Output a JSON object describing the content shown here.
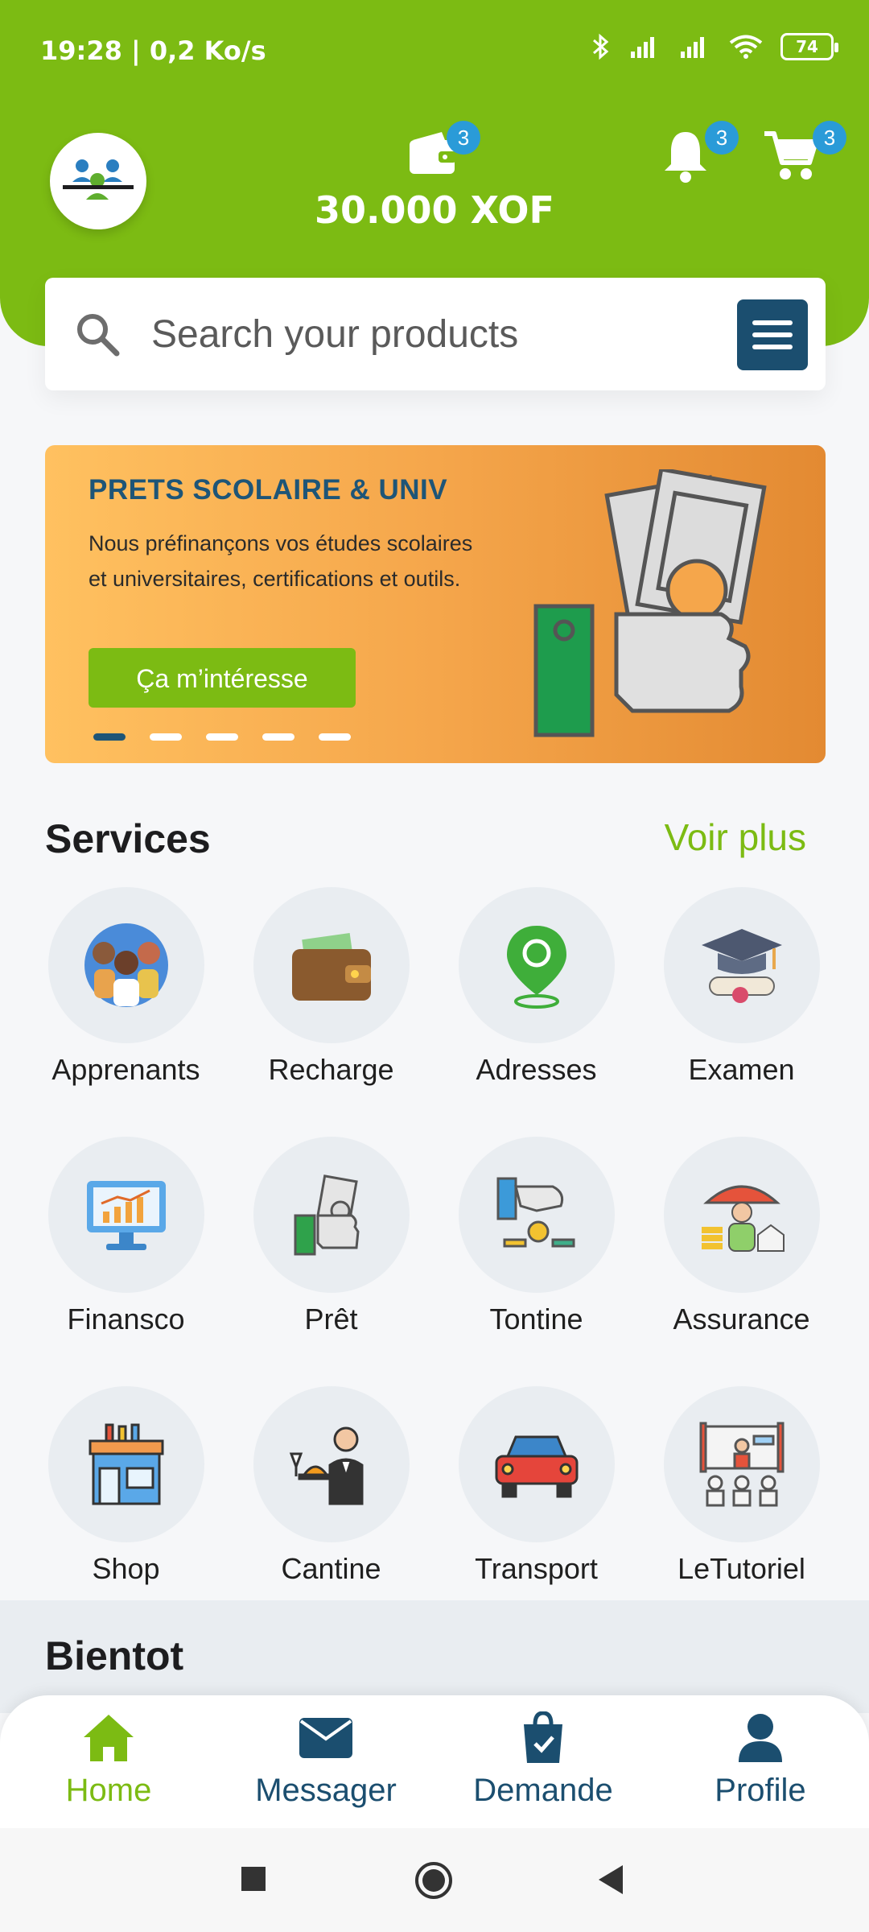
{
  "status_bar": {
    "time_speed": "19:28 | 0,2 Ko/s",
    "battery": "74"
  },
  "header": {
    "wallet_badge": "3",
    "balance": "30.000 XOF",
    "notifications_badge": "3",
    "cart_badge": "3"
  },
  "search": {
    "placeholder": "Search your products"
  },
  "banner": {
    "title": "PRETS SCOLAIRE & UNIV",
    "description": "Nous préfinançons vos études scolaires et universitaires, certifications et outils.",
    "button_label": "Ça m’intéresse",
    "slide_count": 5,
    "active_slide": 1
  },
  "services": {
    "title": "Services",
    "see_more": "Voir plus",
    "items": [
      {
        "label": "Apprenants",
        "icon": "students-icon"
      },
      {
        "label": "Recharge",
        "icon": "wallet-icon"
      },
      {
        "label": "Adresses",
        "icon": "location-pin-icon"
      },
      {
        "label": "Examen",
        "icon": "graduation-cap-icon"
      },
      {
        "label": "Finansco",
        "icon": "monitor-chart-icon"
      },
      {
        "label": "Prêt",
        "icon": "hand-money-icon"
      },
      {
        "label": "Tontine",
        "icon": "coin-hand-icon"
      },
      {
        "label": "Assurance",
        "icon": "umbrella-person-icon"
      },
      {
        "label": "Shop",
        "icon": "shop-icon"
      },
      {
        "label": "Cantine",
        "icon": "waiter-icon"
      },
      {
        "label": "Transport",
        "icon": "car-icon"
      },
      {
        "label": "LeTutoriel",
        "icon": "classroom-icon"
      }
    ]
  },
  "bientot": {
    "title": "Bientot"
  },
  "bottom_nav": {
    "items": [
      {
        "label": "Home",
        "icon": "home-icon",
        "active": true
      },
      {
        "label": "Messager",
        "icon": "mail-icon",
        "active": false
      },
      {
        "label": "Demande",
        "icon": "shopping-bag-icon",
        "active": false
      },
      {
        "label": "Profile",
        "icon": "person-icon",
        "active": false
      }
    ]
  },
  "colors": {
    "brand_green": "#7cbb13",
    "brand_navy": "#1b4e6f",
    "badge_blue": "#2a9bd8",
    "banner_orange": "#f5a64b"
  }
}
